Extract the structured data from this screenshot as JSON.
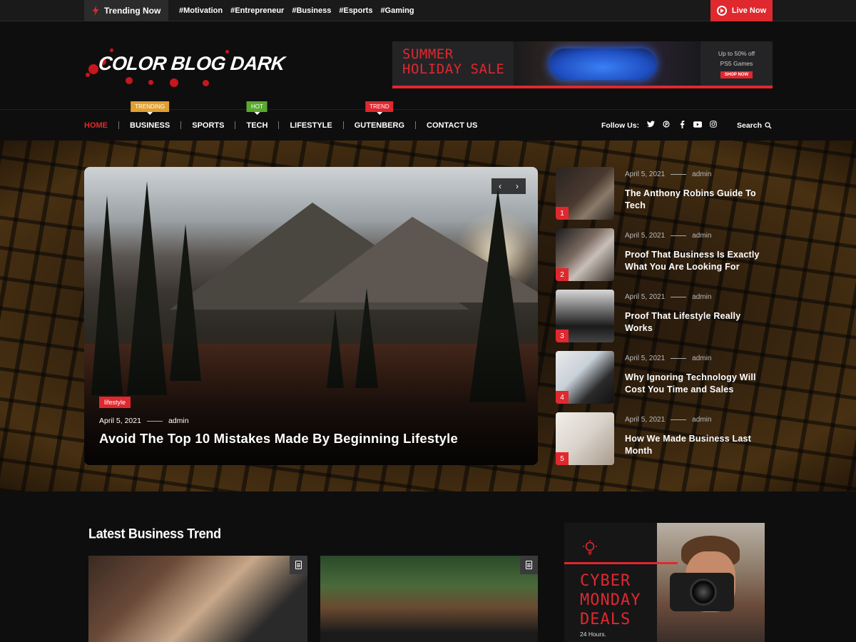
{
  "topbar": {
    "trending_label": "Trending Now",
    "hashtags": [
      "#Motivation",
      "#Entrepreneur",
      "#Business",
      "#Esports",
      "#Gaming"
    ],
    "live_label": "Live Now"
  },
  "header": {
    "logo_text": "COLOR BLOG DARK",
    "ad": {
      "title_line1": "SUMMER",
      "title_line2": "HOLIDAY SALE",
      "side_line1": "Up to 50% off",
      "side_line2": "PS5 Games",
      "button": "SHOP NOW"
    }
  },
  "nav": {
    "items": [
      {
        "label": "HOME",
        "tag": ""
      },
      {
        "label": "BUSINESS",
        "tag": "TRENDING"
      },
      {
        "label": "SPORTS",
        "tag": ""
      },
      {
        "label": "TECH",
        "tag": "HOT"
      },
      {
        "label": "LIFESTYLE",
        "tag": ""
      },
      {
        "label": "GUTENBERG",
        "tag": "TREND"
      },
      {
        "label": "CONTACT US",
        "tag": ""
      }
    ],
    "tag_colors": {
      "TRENDING": "#e0a030",
      "HOT": "#5aaa2e",
      "TREND": "#e0282f"
    },
    "follow_label": "Follow Us:",
    "social_icons": [
      "twitter-icon",
      "pinterest-icon",
      "facebook-icon",
      "youtube-icon",
      "instagram-icon"
    ],
    "search_label": "Search"
  },
  "featured": {
    "category": "lifestyle",
    "date": "April 5, 2021",
    "author": "admin",
    "title": "Avoid The Top 10 Mistakes Made By Beginning Lifestyle"
  },
  "side_posts": [
    {
      "num": "1",
      "date": "April 5, 2021",
      "author": "admin",
      "title": "The Anthony Robins Guide To Tech"
    },
    {
      "num": "2",
      "date": "April 5, 2021",
      "author": "admin",
      "title": "Proof That Business Is Exactly What You Are Looking For"
    },
    {
      "num": "3",
      "date": "April 5, 2021",
      "author": "admin",
      "title": "Proof That Lifestyle Really Works"
    },
    {
      "num": "4",
      "date": "April 5, 2021",
      "author": "admin",
      "title": "Why Ignoring Technology Will Cost You Time and Sales"
    },
    {
      "num": "5",
      "date": "April 5, 2021",
      "author": "admin",
      "title": "How We Made Business Last Month"
    }
  ],
  "latest": {
    "section_title": "Latest Business Trend"
  },
  "promo": {
    "title_line1": "CYBER",
    "title_line2": "MONDAY",
    "title_line3": "DEALS",
    "sub": "24 Hours."
  },
  "colors": {
    "accent": "#e0282f",
    "background": "#0e0e0f"
  }
}
